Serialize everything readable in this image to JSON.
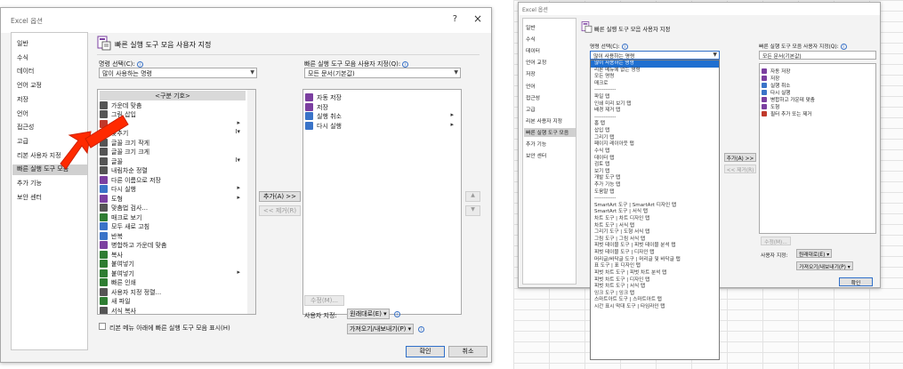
{
  "colors": {
    "accent": "#2f6fc9",
    "arrow": "#ff2a00",
    "selection": "#1f6fd0",
    "purple_icon": "#7b3fa0"
  },
  "left_dialog": {
    "title": "Excel 옵션",
    "help": "?",
    "close": "×",
    "nav": [
      "일반",
      "수식",
      "데이터",
      "언어 교정",
      "저장",
      "언어",
      "접근성",
      "고급",
      "리본 사용자 지정",
      "빠른 실행 도구 모음",
      "추가 기능",
      "보안 센터"
    ],
    "selected_nav": "빠른 실행 도구 모음",
    "heading": "빠른 실행 도구 모음 사용자 지정",
    "choose_label": "명령 선택(C):",
    "choose_value": "많이 사용하는 명령",
    "customize_label": "빠른 실행 도구 모음 사용자 지정(Q):",
    "customize_value": "모든 문서(기본값)",
    "commands": [
      {
        "label": "<구분 기호>",
        "icon": "separator-icon",
        "sub": ""
      },
      {
        "label": "가운데 맞춤",
        "icon": "align-center-icon",
        "sub": ""
      },
      {
        "label": "그림 삽입",
        "icon": "picture-icon",
        "sub": ""
      },
      {
        "label": "삭제",
        "icon": "delete-icon",
        "sub": "▸"
      },
      {
        "label": "맞추기",
        "icon": "fit-icon",
        "sub": "I▾"
      },
      {
        "label": "글꼴 크기 작게",
        "icon": "font-smaller-icon",
        "sub": ""
      },
      {
        "label": "글꼴 크기 크게",
        "icon": "font-larger-icon",
        "sub": ""
      },
      {
        "label": "글꼴",
        "icon": "font-icon",
        "sub": "I▾"
      },
      {
        "label": "내림차순 정렬",
        "icon": "sort-desc-icon",
        "sub": ""
      },
      {
        "label": "다른 이름으로 저장",
        "icon": "save-as-icon",
        "sub": ""
      },
      {
        "label": "다시 실행",
        "icon": "redo-icon",
        "sub": "▸"
      },
      {
        "label": "도형",
        "icon": "shapes-icon",
        "sub": "▸"
      },
      {
        "label": "맞춤법 검사...",
        "icon": "spelling-icon",
        "sub": ""
      },
      {
        "label": "매크로 보기",
        "icon": "macro-icon",
        "sub": ""
      },
      {
        "label": "모두 새로 고침",
        "icon": "refresh-all-icon",
        "sub": ""
      },
      {
        "label": "반복",
        "icon": "repeat-icon",
        "sub": ""
      },
      {
        "label": "병합하고 가운데 맞춤",
        "icon": "merge-center-icon",
        "sub": ""
      },
      {
        "label": "복사",
        "icon": "copy-icon",
        "sub": ""
      },
      {
        "label": "붙여넣기",
        "icon": "paste-icon",
        "sub": ""
      },
      {
        "label": "붙여넣기",
        "icon": "paste-icon",
        "sub": "▸"
      },
      {
        "label": "빠른 인쇄",
        "icon": "quick-print-icon",
        "sub": ""
      },
      {
        "label": "사용자 지정 정렬...",
        "icon": "custom-sort-icon",
        "sub": ""
      },
      {
        "label": "새 파일",
        "icon": "new-file-icon",
        "sub": ""
      },
      {
        "label": "서식 복사",
        "icon": "format-painter-icon",
        "sub": ""
      }
    ],
    "qat_items": [
      {
        "label": "자동 저장",
        "icon": "autosave-icon",
        "sub": ""
      },
      {
        "label": "저장",
        "icon": "save-icon",
        "sub": ""
      },
      {
        "label": "실행 취소",
        "icon": "undo-icon",
        "sub": "▸"
      },
      {
        "label": "다시 실행",
        "icon": "redo-icon",
        "sub": "▸"
      }
    ],
    "add_button": "추가(A) >>",
    "remove_button": "<< 제거(R)",
    "up": "▲",
    "down": "▼",
    "modify_button": "수정(M)...",
    "custom_label": "사용자 지정:",
    "reset_button": "원래대로(E) ▾",
    "import_export_button": "가져오기/내보내기(P) ▾",
    "show_below_ribbon": "리본 메뉴 아래에 빠른 실행 도구 모음 표시(H)",
    "ok": "확인",
    "cancel": "취소"
  },
  "right_dialog": {
    "title": "Excel 옵션",
    "nav": [
      "일반",
      "수식",
      "데이터",
      "언어 교정",
      "저장",
      "언어",
      "접근성",
      "고급",
      "리본 사용자 지정",
      "빠른 실행 도구 모음",
      "추가 기능",
      "보안 센터"
    ],
    "selected_nav": "빠른 실행 도구 모음",
    "heading": "빠른 실행 도구 모음 사용자 지정",
    "choose_label": "명령 선택(C):",
    "choose_value": "많이 사용하는 명령",
    "customize_label": "빠른 실행 도구 모음 사용자 지정(Q):",
    "customize_value": "모든 문서(기본값)",
    "dropdown_options": [
      "많이 사용하는 명령",
      "리본 메뉴에 없는 명령",
      "모든 명령",
      "매크로",
      "------------",
      "파일 탭",
      "인쇄 미리 보기 탭",
      "배경 제거 탭",
      "------------",
      "홈 탭",
      "삽입 탭",
      "그리기 탭",
      "페이지 레이아웃 탭",
      "수식 탭",
      "데이터 탭",
      "검토 탭",
      "보기 탭",
      "개발 도구 탭",
      "추가 기능 탭",
      "도움말 탭",
      "------------",
      "SmartArt 도구 | SmartArt 디자인 탭",
      "SmartArt 도구 | 서식 탭",
      "차트 도구 | 차트 디자인 탭",
      "차트 도구 | 서식 탭",
      "그리기 도구 | 도형 서식 탭",
      "그림 도구 | 그림 서식 탭",
      "피벗 테이블 도구 | 피벗 테이블 분석 탭",
      "피벗 테이블 도구 | 디자인 탭",
      "머리글/바닥글 도구 | 머리글 및 바닥글 탭",
      "표 도구 | 표 디자인 탭",
      "피벗 차트 도구 | 피벗 차트 분석 탭",
      "피벗 차트 도구 | 디자인 탭",
      "피벗 차트 도구 | 서식 탭",
      "잉크 도구 | 잉크 탭",
      "스마트아트 도구 | 스마트아트 탭",
      "시간 표시 막대 도구 | 타임라인 탭"
    ],
    "qat_items": [
      {
        "label": "자동 저장",
        "icon": "autosave-icon"
      },
      {
        "label": "저장",
        "icon": "save-icon"
      },
      {
        "label": "실행 취소",
        "icon": "undo-icon"
      },
      {
        "label": "다시 실행",
        "icon": "redo-icon"
      },
      {
        "label": "병합하고 가운데 맞춤",
        "icon": "merge-center-icon"
      },
      {
        "label": "도형",
        "icon": "shapes-icon"
      },
      {
        "label": "필터 추가 또는 제거",
        "icon": "filter-icon"
      }
    ],
    "add_button": "추가(A) >>",
    "remove_button": "<< 제거(R)",
    "modify_button": "수정(M)...",
    "custom_label": "사용자 지정:",
    "reset_button": "원래대로(E) ▾",
    "import_export_button": "가져오기/내보내기(P) ▾",
    "ok": "확인"
  }
}
